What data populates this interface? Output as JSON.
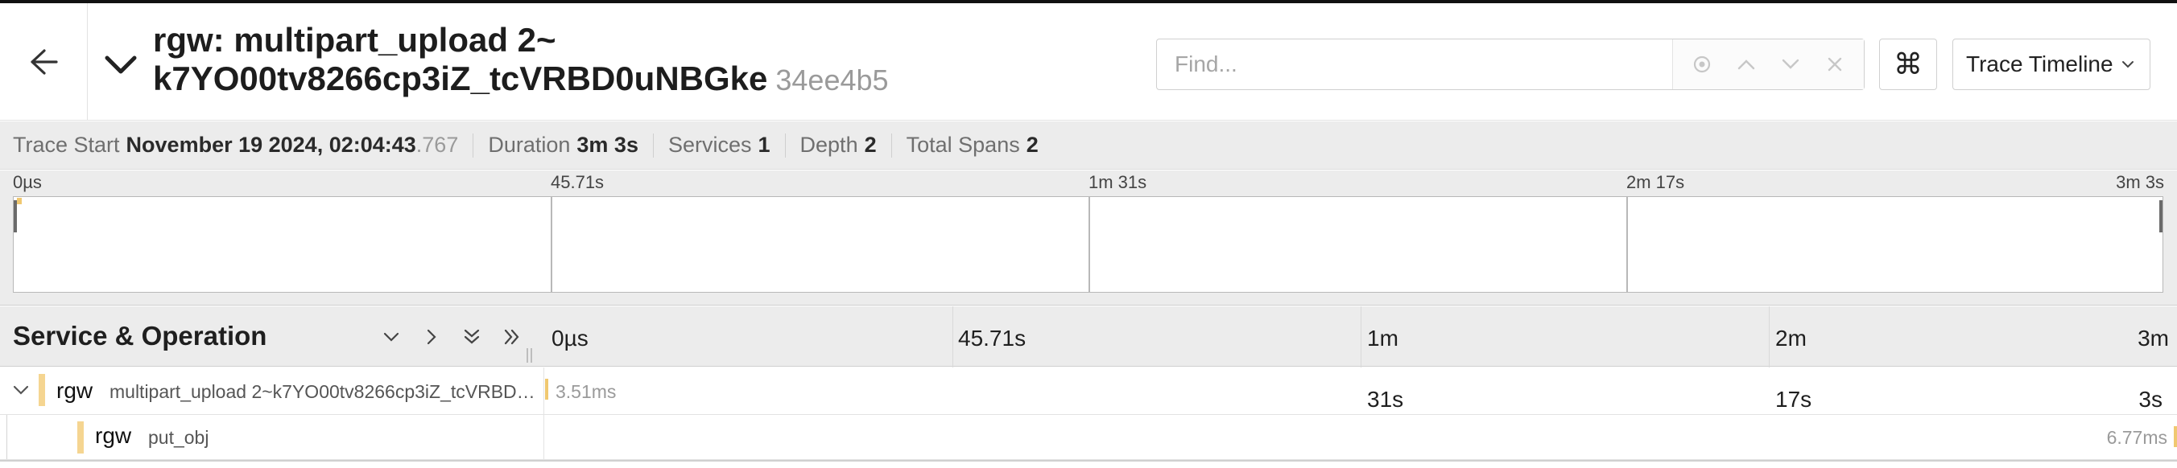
{
  "header": {
    "title_line1": "rgw: multipart_upload 2~",
    "title_line2": "k7YO00tv8266cp3iZ_tcVRBD0uNBGke",
    "trace_id": "34ee4b5",
    "search_placeholder": "Find...",
    "keyboard_icon": "⌘",
    "view_label": "Trace Timeline"
  },
  "summary": [
    {
      "label": "Trace Start",
      "value": "November 19 2024, 02:04:43",
      "value_ms": ".767"
    },
    {
      "label": "Duration",
      "value": "3m 3s"
    },
    {
      "label": "Services",
      "value": "1"
    },
    {
      "label": "Depth",
      "value": "2"
    },
    {
      "label": "Total Spans",
      "value": "2"
    }
  ],
  "minimap": {
    "ticks": [
      "0µs",
      "45.71s",
      "1m 31s",
      "2m 17s",
      "3m 3s"
    ]
  },
  "timeline": {
    "column_title": "Service & Operation",
    "ticks": [
      "0µs",
      "45.71s",
      "1m",
      "2m",
      "3m"
    ],
    "grid_subticks": [
      "31s",
      "17s",
      "3s"
    ]
  },
  "spans": [
    {
      "service": "rgw",
      "operation": "multipart_upload 2~k7YO00tv8266cp3iZ_tcVRBD0uNBGke",
      "duration": "3.51ms",
      "depth": 0,
      "start_fraction": 0,
      "duration_fraction": 1.92e-05
    },
    {
      "service": "rgw",
      "operation": "put_obj",
      "duration": "6.77ms",
      "depth": 1,
      "start_fraction": 1,
      "duration_fraction": 3.7e-05
    }
  ],
  "colors": {
    "service_rgw": "#f5d591",
    "span_bar": "#f0c870",
    "panel_bg": "#ececec"
  },
  "icons": {
    "back": "arrow-left-icon",
    "collapse": "chevron-down-icon",
    "find_match": "locate-icon",
    "prev": "chevron-up-icon",
    "next": "chevron-down-icon",
    "clear": "close-icon"
  }
}
